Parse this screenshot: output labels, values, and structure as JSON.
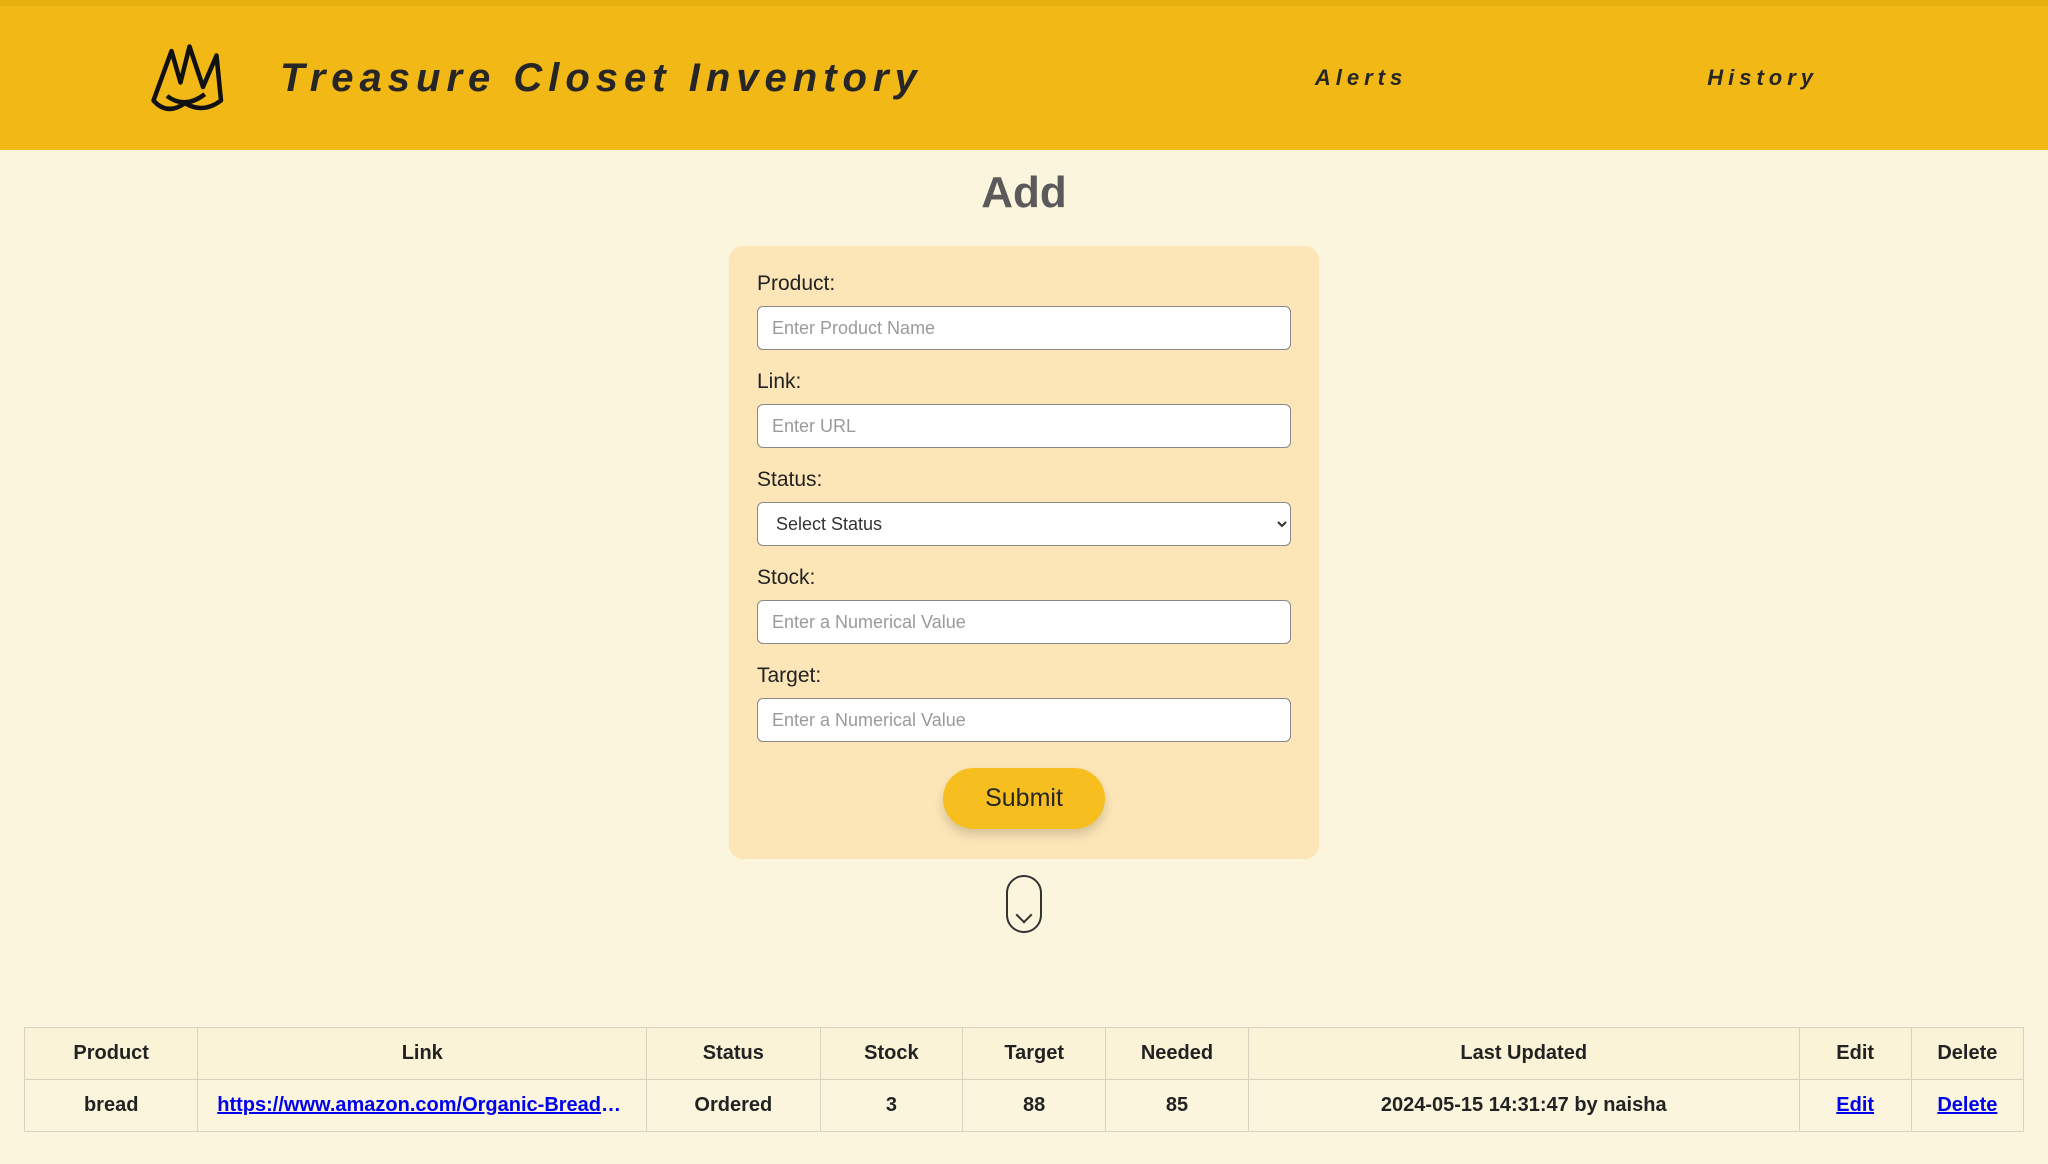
{
  "header": {
    "title": "Treasure Closet Inventory",
    "nav": {
      "alerts": "Alerts",
      "history": "History"
    }
  },
  "page": {
    "title": "Add"
  },
  "form": {
    "product_label": "Product:",
    "product_placeholder": "Enter Product Name",
    "link_label": "Link:",
    "link_placeholder": "Enter URL",
    "status_label": "Status:",
    "status_selected": "Select Status",
    "stock_label": "Stock:",
    "stock_placeholder": "Enter a Numerical Value",
    "target_label": "Target:",
    "target_placeholder": "Enter a Numerical Value",
    "submit_label": "Submit"
  },
  "table": {
    "headers": {
      "product": "Product",
      "link": "Link",
      "status": "Status",
      "stock": "Stock",
      "target": "Target",
      "needed": "Needed",
      "last_updated": "Last Updated",
      "edit": "Edit",
      "delete": "Delete"
    },
    "rows": [
      {
        "product": "bread",
        "link": "https://www.amazon.com/Organic-Bread-Heav…",
        "status": "Ordered",
        "stock": "3",
        "target": "88",
        "needed": "85",
        "last_updated": "2024-05-15 14:31:47 by naisha",
        "edit_label": "Edit",
        "delete_label": "Delete"
      }
    ]
  }
}
